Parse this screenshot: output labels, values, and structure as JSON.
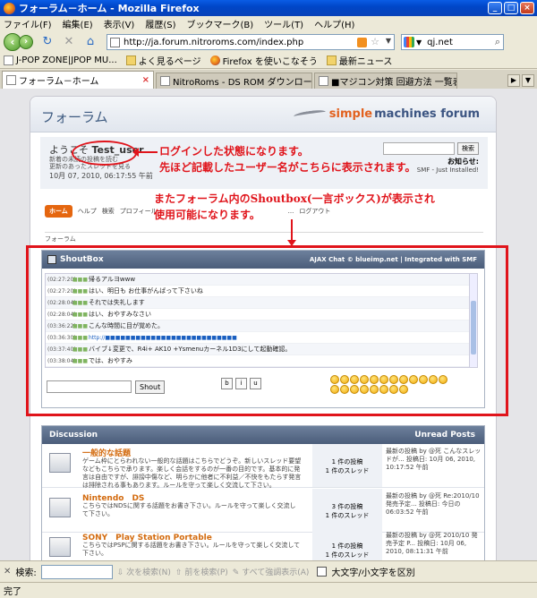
{
  "window": {
    "title": "フォーラム－ホーム - Mozilla Firefox"
  },
  "menubar": [
    "ファイル(F)",
    "編集(E)",
    "表示(V)",
    "履歴(S)",
    "ブックマーク(B)",
    "ツール(T)",
    "ヘルプ(H)"
  ],
  "nav": {
    "url": "http://ja.forum.nitroroms.com/index.php",
    "search_value": "qj.net"
  },
  "bookmarks": [
    "J-POP ZONE|JPOP MU...",
    "よく見るページ",
    "Firefox を使いこなそう",
    "最新ニュース"
  ],
  "tabs": [
    {
      "label": "フォーラム－ホーム",
      "active": true
    },
    {
      "label": "NitroRoms - DS ROM ダウンロード PS...",
      "active": false
    },
    {
      "label": "■マジコン対策 回避方法 一覧表 ※9...",
      "active": false
    }
  ],
  "forum": {
    "title": "フォーラム",
    "logo_a": "simple",
    "logo_b": "machines forum",
    "welcome_prefix": "ようこそ",
    "username": "Test_user",
    "new_messages": "新着の未読の投稿を読む",
    "recent": "更新のあったスレッドを見る",
    "datetime": "10月 07, 2010, 06:17:55 午前",
    "search_button": "検索",
    "news_title": "お知らせ:",
    "news_text": "SMF - Just Installed!",
    "menu": [
      "ホーム",
      "ヘルプ",
      "検索",
      "プロフィール",
      "...",
      "ログアウト"
    ],
    "breadcrumb": "フォーラム"
  },
  "shoutbox": {
    "title": "ShoutBox",
    "ajax_credit": "AJAX Chat © blueimp.net | Integrated with SMF",
    "messages": [
      {
        "time": "(02:27:20)",
        "nick": "■■■",
        "text": "帰るアルヨwww",
        "link": false
      },
      {
        "time": "(02:27:20)",
        "nick": "■■■",
        "text": "はい、明日も お仕事がんばって下さいね",
        "link": false
      },
      {
        "time": "(02:28:04)",
        "nick": "■■■",
        "text": "それでは失礼します",
        "link": false
      },
      {
        "time": "(02:28:04)",
        "nick": "■■■",
        "text": "はい、おやすみなさい",
        "link": false
      },
      {
        "time": "(03:36:22)",
        "nick": "■■■",
        "text": "こんな時間に目が覚めた。",
        "link": false
      },
      {
        "time": "(03:36:30)",
        "nick": "■■■",
        "text": "http://■■■■■■■■■■■■■■■■■■■■■■■■■■",
        "link": true
      },
      {
        "time": "(03:37:40)",
        "nick": "■■■",
        "text": "バイブ↓変更で、R4i+ AK10 +Ysmenuカーネル1D3にして起動確認。",
        "link": false
      },
      {
        "time": "(03:38:04)",
        "nick": "■■■",
        "text": "では、おやすみ",
        "link": false
      }
    ],
    "shout_button": "Shout",
    "format": [
      "b",
      "i",
      "u"
    ]
  },
  "discussion": {
    "title": "Discussion",
    "unread": "Unread Posts",
    "boards": [
      {
        "name": "一般的な話題",
        "desc": "ゲーム枠にとらわれない一般的な話題はこちらでどうぞ。新しいスレッド要望などもこちらで承ります。楽しく会話をするのが一番の目的です。基本的に発言は自由ですが、誹謗中傷など、明らかに他者に不利益／不快をもたらす発言は排除される事もあります。ルールを守って楽しく交流して下さい。",
        "posts": "1 件の投稿",
        "threads": "1 件のスレッド",
        "last": "最新の投稿 by @死 こんなスレッドが... 投稿日: 10月 06, 2010, 10:17:52 午前"
      },
      {
        "name": "Nintendo　DS",
        "desc": "こちらではNDSに関する話題をお書き下さい。ルールを守って楽しく交流して下さい。",
        "posts": "3 件の投稿",
        "threads": "1 件のスレッド",
        "last": "最新の投稿 by @死 Re:2010/10 発売予定... 投稿日: 今日の06:03:52 午前"
      },
      {
        "name": "SONY　Play Station Portable",
        "desc": "こちらではPSPに関する話題をお書き下さい。ルールを守って楽しく交流して下さい。",
        "posts": "1 件の投稿",
        "threads": "1 件のスレッド",
        "last": "最新の投稿 by @死 2010/10 発売予定 P... 投稿日: 10月 06, 2010, 08:11:31 午前"
      }
    ]
  },
  "annotations": {
    "line1": "ログインした状態になります。",
    "line2": "先ほど記載したユーザー名がこちらに表示されます。",
    "line3": "またフォーラム内のShoutbox(一言ボックス)が表示され",
    "line4": "使用可能になります。"
  },
  "findbar": {
    "label": "検索:",
    "next": "次を検索(N)",
    "prev": "前を検索(P)",
    "highlight": "すべて強調表示(A)",
    "case": "大文字/小文字を区別"
  },
  "status": "完了",
  "colors": {
    "accent_orange": "#e5660f",
    "annotation_red": "#e0141b",
    "header_blue": "#4b5d7a"
  }
}
